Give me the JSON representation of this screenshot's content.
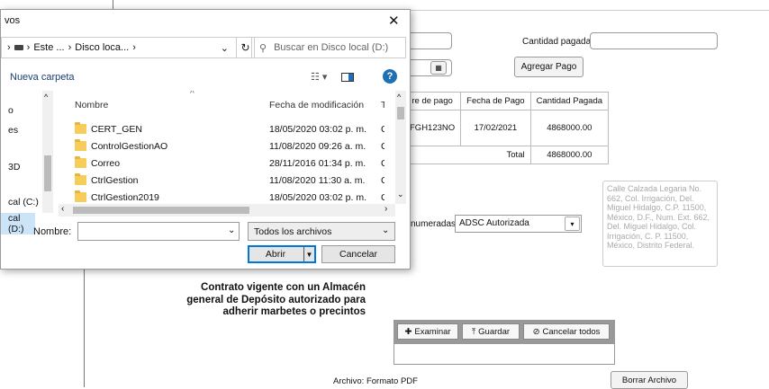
{
  "form": {
    "cantidad_pagada_label": "Cantidad pagada",
    "agregar_pago_label": "Agregar Pago",
    "table": {
      "headers": [
        "re de pago",
        "Fecha de Pago",
        "Cantidad Pagada"
      ],
      "row": [
        "FGH123NO",
        "17/02/2021",
        "4868000.00"
      ],
      "total_label": "Total",
      "total_value": "4868000.00"
    },
    "numeradas_label": "numeradas",
    "adsc_value": "ADSC Autorizada",
    "address_text": "Calle Calzada Legaria No. 662, Col. Irrigación, Del. Miguel Hidalgo, C.P. 11500, México, D.F., Num. Ext. 662, Del. Miguel Hidalgo, Col. Irrigación, C. P. 11500, México, Distrito Federal.",
    "contrato_text": "Contrato vigente con un Almacén general de Depósito autorizado para adherir marbetes o precintos",
    "examinar_label": "Examinar",
    "guardar_label": "Guardar",
    "cancelar_todos_label": "Cancelar todos",
    "archivo_label": "Archivo: Formato PDF",
    "borrar_label": "Borrar Archivo"
  },
  "dialog": {
    "title": "vos",
    "close_glyph": "✕",
    "breadcrumb": [
      "Este ...",
      "Disco loca..."
    ],
    "search_placeholder": "Buscar en Disco local (D:)",
    "new_folder_label": "Nueva carpeta",
    "nav_items": [
      "o",
      "es",
      "3D",
      "cal (C:)",
      "cal (D:)"
    ],
    "columns": {
      "name": "Nombre",
      "date": "Fecha de modificación",
      "type": "Ti"
    },
    "files": [
      {
        "name": "CERT_GEN",
        "date": "18/05/2020 03:02 p. m.",
        "type": "C"
      },
      {
        "name": "ControlGestionAO",
        "date": "11/08/2020 09:26 a. m.",
        "type": "C"
      },
      {
        "name": "Correo",
        "date": "28/11/2016 01:34 p. m.",
        "type": "C"
      },
      {
        "name": "CtrlGestion",
        "date": "11/08/2020 11:30 a. m.",
        "type": "C"
      },
      {
        "name": "CtrlGestion2019",
        "date": "18/05/2020 03:02 p. m.",
        "type": "C"
      }
    ],
    "filename_label": "Nombre:",
    "filetype_value": "Todos los archivos",
    "open_label": "Abrir",
    "cancel_label": "Cancelar"
  }
}
